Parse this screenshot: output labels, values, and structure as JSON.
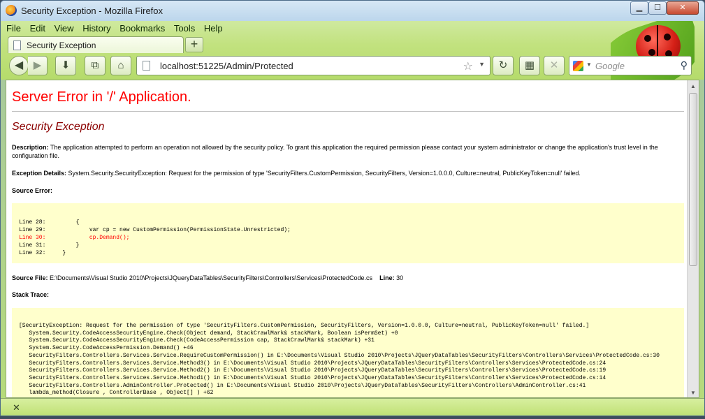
{
  "window": {
    "title": "Security Exception - Mozilla Firefox",
    "min_glyph": "▁",
    "max_glyph": "☐",
    "close_glyph": "✕"
  },
  "menu": {
    "items": [
      "File",
      "Edit",
      "View",
      "History",
      "Bookmarks",
      "Tools",
      "Help"
    ]
  },
  "tabs": [
    {
      "label": "Security Exception",
      "icon": "page-icon"
    }
  ],
  "new_tab_glyph": "+",
  "nav": {
    "back_glyph": "◀",
    "forward_glyph": "▶",
    "download_glyph": "⬇",
    "newwindow_glyph": "⧉",
    "home_glyph": "⌂",
    "url": "localhost:51225/Admin/Protected",
    "star_glyph": "☆",
    "dropdown_glyph": "▼",
    "reload_glyph": "↻",
    "sidebar_glyph": "▦",
    "stop_glyph": "✕"
  },
  "search": {
    "placeholder": "Google",
    "dropdown_glyph": "▼",
    "magnifier_glyph": "⚲"
  },
  "page": {
    "heading": "Server Error in '/' Application.",
    "subheading": "Security Exception",
    "description_label": "Description:",
    "description_text": " The application attempted to perform an operation not allowed by the security policy.  To grant this application the required permission please contact your system administrator or change the application's trust level in the configuration file.",
    "exception_label": "Exception Details:",
    "exception_text": " System.Security.SecurityException: Request for the permission of type 'SecurityFilters.CustomPermission, SecurityFilters, Version=1.0.0.0, Culture=neutral, PublicKeyToken=null' failed.",
    "source_error_label": "Source Error:",
    "source_lines": [
      {
        "text": "Line 28:         {",
        "highlight": false
      },
      {
        "text": "Line 29:             var cp = new CustomPermission(PermissionState.Unrestricted);",
        "highlight": false
      },
      {
        "text": "Line 30:             cp.Demand();",
        "highlight": true
      },
      {
        "text": "Line 31:         }",
        "highlight": false
      },
      {
        "text": "Line 32:     }",
        "highlight": false
      }
    ],
    "source_file_label": "Source File:",
    "source_file_text": " E:\\Documents\\Visual Studio 2010\\Projects\\JQueryDataTables\\SecurityFilters\\Controllers\\Services\\ProtectedCode.cs",
    "line_label": "Line:",
    "line_text": " 30",
    "stack_trace_label": "Stack Trace:",
    "stack_lines": [
      "[SecurityException: Request for the permission of type 'SecurityFilters.CustomPermission, SecurityFilters, Version=1.0.0.0, Culture=neutral, PublicKeyToken=null' failed.]",
      "   System.Security.CodeAccessSecurityEngine.Check(Object demand, StackCrawlMark& stackMark, Boolean isPermSet) +0",
      "   System.Security.CodeAccessSecurityEngine.Check(CodeAccessPermission cap, StackCrawlMark& stackMark) +31",
      "   System.Security.CodeAccessPermission.Demand() +46",
      "   SecurityFilters.Controllers.Services.Service.RequireCustomPermission() in E:\\Documents\\Visual Studio 2010\\Projects\\JQueryDataTables\\SecurityFilters\\Controllers\\Services\\ProtectedCode.cs:30",
      "   SecurityFilters.Controllers.Services.Service.Method3() in E:\\Documents\\Visual Studio 2010\\Projects\\JQueryDataTables\\SecurityFilters\\Controllers\\Services\\ProtectedCode.cs:24",
      "   SecurityFilters.Controllers.Services.Service.Method2() in E:\\Documents\\Visual Studio 2010\\Projects\\JQueryDataTables\\SecurityFilters\\Controllers\\Services\\ProtectedCode.cs:19",
      "   SecurityFilters.Controllers.Services.Service.Method1() in E:\\Documents\\Visual Studio 2010\\Projects\\JQueryDataTables\\SecurityFilters\\Controllers\\Services\\ProtectedCode.cs:14",
      "   SecurityFilters.Controllers.AdminController.Protected() in E:\\Documents\\Visual Studio 2010\\Projects\\JQueryDataTables\\SecurityFilters\\Controllers\\AdminController.cs:41",
      "   lambda_method(Closure , ControllerBase , Object[] ) +62"
    ]
  },
  "scrollbar": {
    "up_glyph": "▲",
    "down_glyph": "▼"
  },
  "findbar": {
    "close_glyph": "✕"
  },
  "colors": {
    "error_heading": "#ff0000",
    "subheading": "#8b0000",
    "code_background": "#ffffcc",
    "chrome_green": "#b5db6b"
  }
}
